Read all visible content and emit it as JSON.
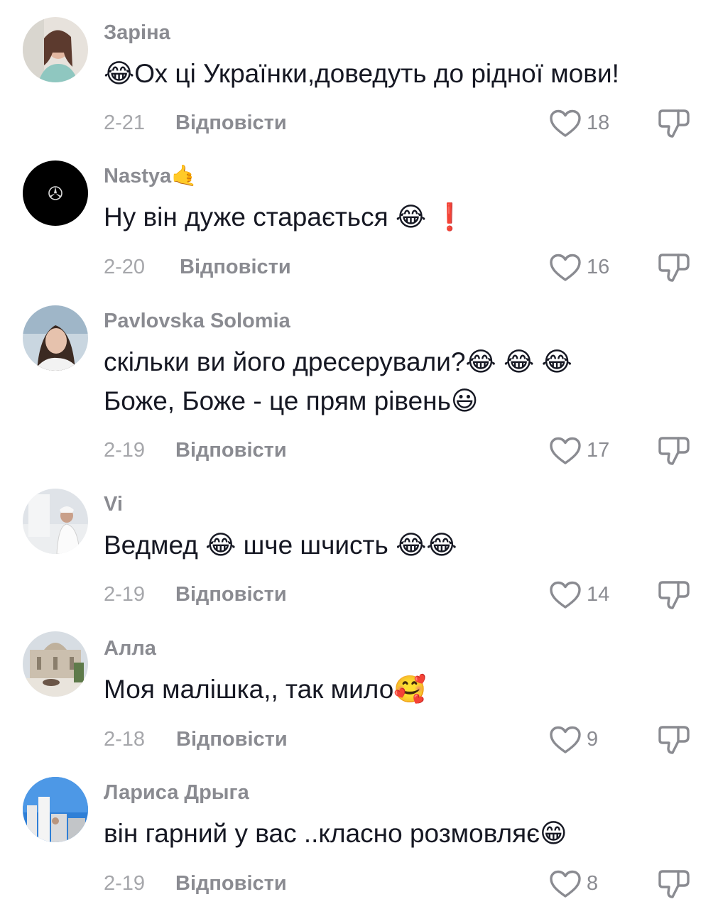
{
  "comments": [
    {
      "username": "Заріна",
      "text": "😂Ох ці Українки,доведуть до рідної мови!",
      "date": "2-21",
      "reply_label": "Відповісти",
      "likes": "18"
    },
    {
      "username": "Nastya🤙",
      "text": "Ну він дуже старається 😂 ❗",
      "date": "2-20",
      "reply_label": "Відповісти",
      "likes": "16"
    },
    {
      "username": "Pavlovska Solomia",
      "text": "скільки ви його дресерували?😂 😂 😂 Боже, Боже - це прям рівень😃",
      "date": "2-19",
      "reply_label": "Відповісти",
      "likes": "17"
    },
    {
      "username": "Vi",
      "text": "Ведмед 😂 шче шчисть 😂😂",
      "date": "2-19",
      "reply_label": "Відповісти",
      "likes": "14"
    },
    {
      "username": "Алла",
      "text": "Моя малішка,, так мило🥰",
      "date": "2-18",
      "reply_label": "Відповісти",
      "likes": "9"
    },
    {
      "username": "Лариса Дрыга",
      "text": "він гарний у вас ..класно розмовляє😁",
      "date": "2-19",
      "reply_label": "Відповісти",
      "likes": "8"
    }
  ],
  "icons": {
    "like": "heart-outline-icon",
    "dislike": "thumbs-down-outline-icon"
  },
  "colors": {
    "text": "#161823",
    "username": "#8a8b91",
    "meta": "#a6a7ab"
  }
}
